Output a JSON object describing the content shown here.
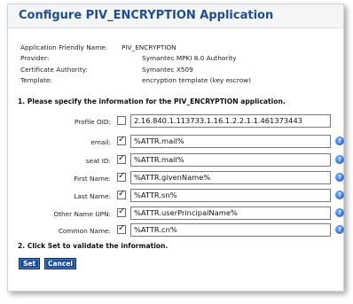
{
  "title": "Configure PIV_ENCRYPTION Application",
  "info": [
    {
      "label": "Application Friendly Name:",
      "value": "PIV_ENCRYPTION"
    },
    {
      "label": "Provider:",
      "value": "Symantec MPKI 8.0 Authority"
    },
    {
      "label": "Certificate Authority:",
      "value": "Symantec X509"
    },
    {
      "label": "Template:",
      "value": "encryption template (key escrow)"
    }
  ],
  "section1": "1. Please specify the information for the PIV_ENCRYPTION application.",
  "fields": [
    {
      "label": "Profile OID:",
      "value": "2.16.840.1.113733.1.16.1.2.2.1.1.461373443",
      "checked": false,
      "help": false
    },
    {
      "label": "email:",
      "value": "%ATTR.mail%",
      "checked": true,
      "help": true
    },
    {
      "label": "seat ID:",
      "value": "%ATTR.mail%",
      "checked": true,
      "help": true
    },
    {
      "label": "First Name:",
      "value": "%ATTR.givenName%",
      "checked": true,
      "help": true
    },
    {
      "label": "Last Name:",
      "value": "%ATTR.sn%",
      "checked": true,
      "help": true
    },
    {
      "label": "Other Name UPN:",
      "value": "%ATTR.userPrincipalName%",
      "checked": true,
      "help": true
    },
    {
      "label": "Common Name:",
      "value": "%ATTR.cn%",
      "checked": true,
      "help": true
    }
  ],
  "section2": "2. Click Set to validate the information.",
  "buttons": {
    "set": "Set",
    "cancel": "Cancel"
  },
  "colors": {
    "title": "#1f4e8c",
    "button": "#1e4f9a"
  }
}
